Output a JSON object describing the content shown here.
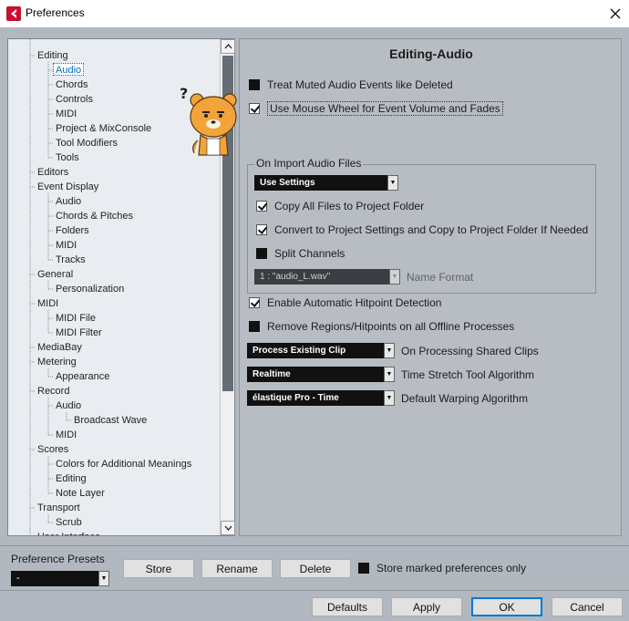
{
  "window": {
    "title": "Preferences"
  },
  "tree": {
    "items": [
      {
        "label": "Editing",
        "level": 1
      },
      {
        "label": "Audio",
        "level": 2,
        "selected": true
      },
      {
        "label": "Chords",
        "level": 2
      },
      {
        "label": "Controls",
        "level": 2
      },
      {
        "label": "MIDI",
        "level": 2
      },
      {
        "label": "Project & MixConsole",
        "level": 2
      },
      {
        "label": "Tool Modifiers",
        "level": 2
      },
      {
        "label": "Tools",
        "level": 2
      },
      {
        "label": "Editors",
        "level": 1
      },
      {
        "label": "Event Display",
        "level": 1
      },
      {
        "label": "Audio",
        "level": 2
      },
      {
        "label": "Chords & Pitches",
        "level": 2
      },
      {
        "label": "Folders",
        "level": 2
      },
      {
        "label": "MIDI",
        "level": 2
      },
      {
        "label": "Tracks",
        "level": 2
      },
      {
        "label": "General",
        "level": 1
      },
      {
        "label": "Personalization",
        "level": 2
      },
      {
        "label": "MIDI",
        "level": 1
      },
      {
        "label": "MIDI File",
        "level": 2
      },
      {
        "label": "MIDI Filter",
        "level": 2
      },
      {
        "label": "MediaBay",
        "level": 1
      },
      {
        "label": "Metering",
        "level": 1
      },
      {
        "label": "Appearance",
        "level": 2
      },
      {
        "label": "Record",
        "level": 1
      },
      {
        "label": "Audio",
        "level": 2
      },
      {
        "label": "Broadcast Wave",
        "level": 3
      },
      {
        "label": "MIDI",
        "level": 2
      },
      {
        "label": "Scores",
        "level": 1
      },
      {
        "label": "Colors for Additional Meanings",
        "level": 2
      },
      {
        "label": "Editing",
        "level": 2
      },
      {
        "label": "Note Layer",
        "level": 2
      },
      {
        "label": "Transport",
        "level": 1
      },
      {
        "label": "Scrub",
        "level": 2
      },
      {
        "label": "User Interface",
        "level": 1
      }
    ]
  },
  "panel": {
    "title": "Editing-Audio",
    "treat_muted": {
      "label": "Treat Muted Audio Events like Deleted",
      "checked": false
    },
    "mouse_wheel": {
      "label": "Use Mouse Wheel for Event Volume and Fades",
      "checked": true
    },
    "import_group": {
      "label": "On Import Audio Files",
      "mode_select": "Use Settings",
      "copy_files": {
        "label": "Copy All Files to Project Folder",
        "checked": true
      },
      "convert": {
        "label": "Convert to Project Settings and Copy to Project Folder If Needed",
        "checked": true
      },
      "split": {
        "label": "Split Channels",
        "checked": false
      },
      "name_format_value": "1 : \"audio_L.wav\"",
      "name_format_label": "Name Format"
    },
    "hitpoint": {
      "label": "Enable Automatic Hitpoint Detection",
      "checked": true
    },
    "remove_regions": {
      "label": "Remove Regions/Hitpoints on all Offline Processes",
      "checked": false
    },
    "shared_clips": {
      "value": "Process Existing Clip",
      "label": "On Processing Shared Clips"
    },
    "time_stretch": {
      "value": "Realtime",
      "label": "Time Stretch Tool Algorithm"
    },
    "warping": {
      "value": "élastique Pro - Time",
      "label": "Default Warping Algorithm"
    }
  },
  "footer": {
    "presets_label": "Preference Presets",
    "preset_value": "-",
    "store": "Store",
    "rename": "Rename",
    "delete": "Delete",
    "store_marked": {
      "label": "Store marked preferences only",
      "checked": false
    },
    "defaults": "Defaults",
    "apply": "Apply",
    "ok": "OK",
    "cancel": "Cancel"
  },
  "colors": {
    "dialog_bg": "#b2b8bf",
    "selection_text": "#0070b8",
    "accent": "#0078d7",
    "app_icon": "#c8102e"
  }
}
